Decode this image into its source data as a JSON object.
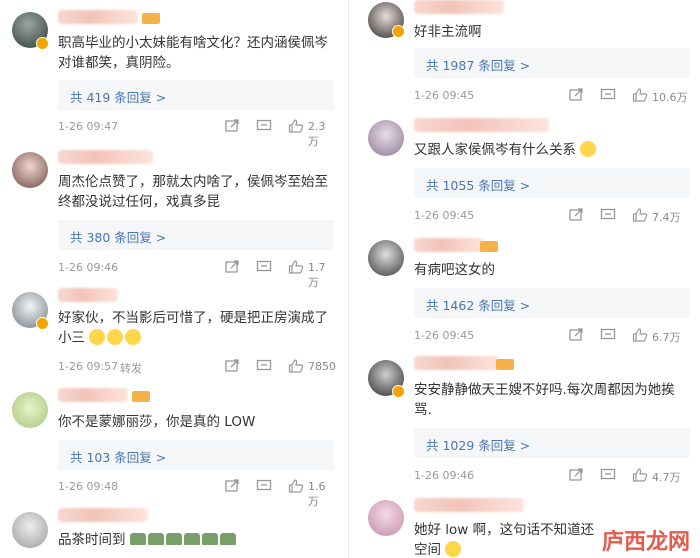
{
  "left_comments": [
    {
      "text": "职高毕业的小太妹能有啥文化？还内涵侯佩岑对谁都笑，真阴险。",
      "reply": "共 419 条回复 >",
      "time": "1-26 09:47",
      "extra": "",
      "likes": "2.3万"
    },
    {
      "text": "周杰伦点赞了，那就太内啥了，侯佩岑至始至终都没说过任何，戏真多昆",
      "reply": "共 380 条回复 >",
      "time": "1-26 09:46",
      "extra": "",
      "likes": "1.7万"
    },
    {
      "text": "好家伙，不当影后可惜了，硬是把正房演成了小三",
      "reply": "",
      "time": "1-26 09:57",
      "extra": "转发",
      "likes": "7850"
    },
    {
      "text": "你不是蒙娜丽莎，你是真的 LOW",
      "reply": "共 103 条回复 >",
      "time": "1-26 09:48",
      "extra": "",
      "likes": "1.6万"
    },
    {
      "text": "品茶时间到",
      "reply": "",
      "time": "",
      "extra": "",
      "likes": ""
    }
  ],
  "right_comments": [
    {
      "text": "好非主流啊",
      "reply": "共 1987 条回复 >",
      "time": "1-26 09:45",
      "extra": "",
      "likes": "10.6万"
    },
    {
      "text": "又跟人家侯佩岑有什么关系",
      "reply": "共 1055 条回复 >",
      "time": "1-26 09:45",
      "extra": "",
      "likes": "7.4万"
    },
    {
      "text": "有病吧这女的",
      "reply": "共 1462 条回复 >",
      "time": "1-26 09:45",
      "extra": "",
      "likes": "6.7万"
    },
    {
      "text": "安安静静做天王嫂不好吗.每次周都因为她挨骂.",
      "reply": "共 1029 条回复 >",
      "time": "1-26 09:46",
      "extra": "",
      "likes": "4.7万"
    },
    {
      "text": "她好 low 啊，这句话不知道还",
      "text2": "空间",
      "reply": "",
      "time": "",
      "extra": "",
      "likes": ""
    }
  ],
  "watermark": "庐西龙网",
  "icons": [
    "share-icon",
    "comment-icon",
    "like-icon",
    "verified-badge-icon",
    "emoji-icon",
    "cake-emoji-icon"
  ]
}
